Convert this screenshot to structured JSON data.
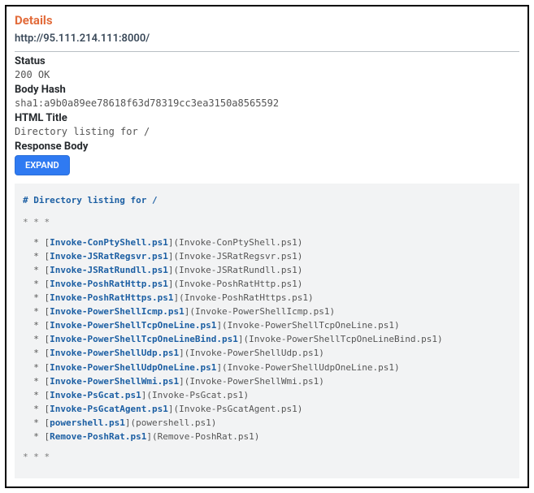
{
  "heading": "Details",
  "url": "http://95.111.214.111:8000/",
  "labels": {
    "status": "Status",
    "body_hash": "Body Hash",
    "html_title": "HTML Title",
    "response_body": "Response Body"
  },
  "values": {
    "status": "200 OK",
    "body_hash": "sha1:a9b0a89ee78618f63d78319cc3ea3150a8565592",
    "html_title": "Directory listing for /"
  },
  "expand_button": "EXPAND",
  "code": {
    "heading": "# Directory listing for /",
    "stars": "* * *",
    "files": [
      "Invoke-ConPtyShell.ps1",
      "Invoke-JSRatRegsvr.ps1",
      "Invoke-JSRatRundll.ps1",
      "Invoke-PoshRatHttp.ps1",
      "Invoke-PoshRatHttps.ps1",
      "Invoke-PowerShellIcmp.ps1",
      "Invoke-PowerShellTcpOneLine.ps1",
      "Invoke-PowerShellTcpOneLineBind.ps1",
      "Invoke-PowerShellUdp.ps1",
      "Invoke-PowerShellUdpOneLine.ps1",
      "Invoke-PowerShellWmi.ps1",
      "Invoke-PsGcat.ps1",
      "Invoke-PsGcatAgent.ps1",
      "powershell.ps1",
      "Remove-PoshRat.ps1"
    ]
  }
}
